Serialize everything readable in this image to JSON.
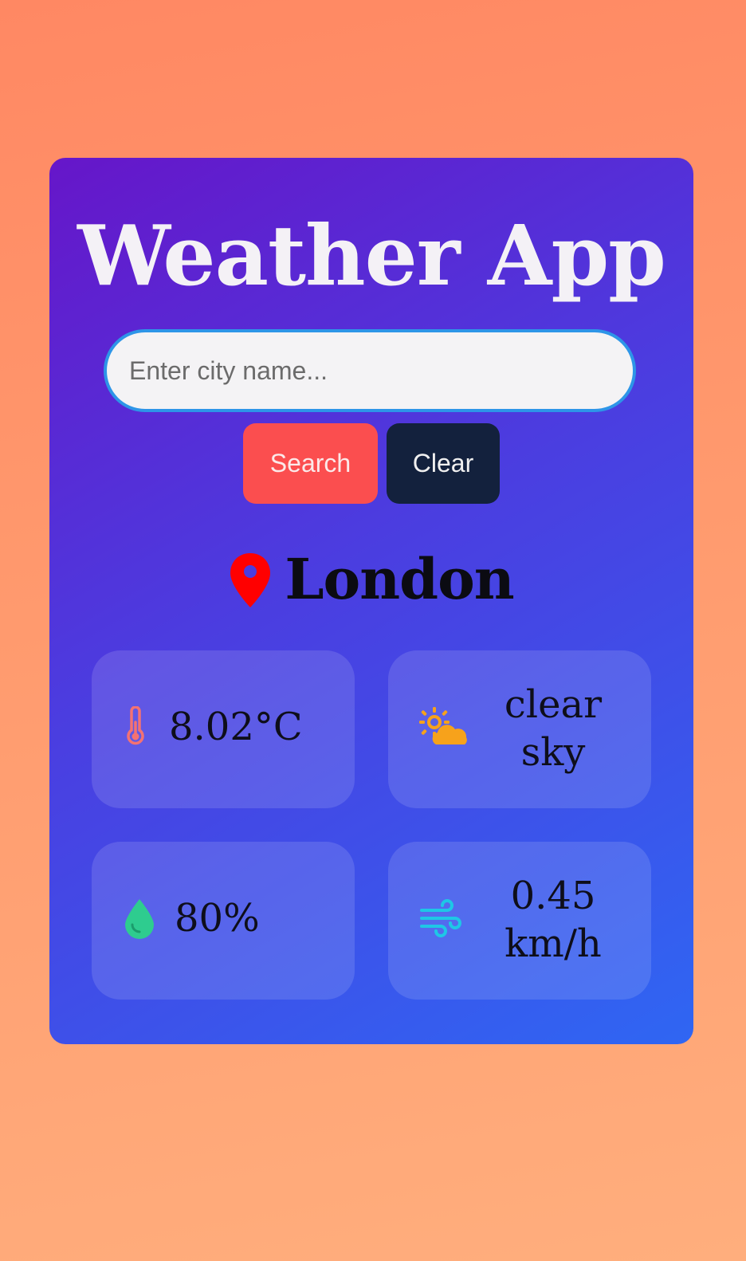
{
  "app": {
    "title": "Weather App"
  },
  "search": {
    "placeholder": "Enter city name...",
    "value": "",
    "search_label": "Search",
    "clear_label": "Clear"
  },
  "location": {
    "city": "London",
    "icon": "map-pin-icon"
  },
  "stats": {
    "temperature": {
      "value": "8.02°C",
      "icon": "thermometer-icon"
    },
    "condition": {
      "line1": "clear",
      "line2": "sky",
      "icon": "partly-sunny-icon"
    },
    "humidity": {
      "value": "80%",
      "icon": "water-drop-icon"
    },
    "wind": {
      "line1": "0.45",
      "line2": "km/h",
      "icon": "wind-icon"
    }
  },
  "colors": {
    "background": "#ff9a6e",
    "card_gradient_start": "#6616c9",
    "card_gradient_end": "#2f66f3",
    "search_button": "#fb4e4f",
    "clear_button": "#13213d",
    "input_border": "#2d95e8",
    "pin": "#ff0000",
    "thermometer": "#f47272",
    "sun_cloud": "#f7a21b",
    "drop": "#2ecc8f",
    "wind": "#1ec7e6"
  }
}
